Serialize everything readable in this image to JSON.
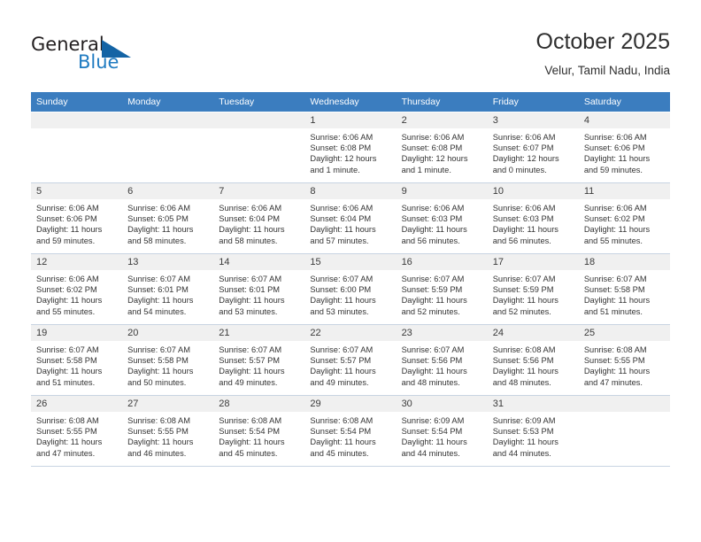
{
  "brand": {
    "name_part1": "General",
    "name_part2": "Blue",
    "triangle_icon": "triangle-logo-icon",
    "accent_color": "#1464a5",
    "blue_text_color": "#1f7bc1"
  },
  "header": {
    "title": "October 2025",
    "location": "Velur, Tamil Nadu, India"
  },
  "colors": {
    "header_row_bg": "#3b7dbf",
    "header_row_text": "#ffffff",
    "daynum_bg": "#f0f0f0",
    "cell_border": "#c8d4e2",
    "body_text": "#333333"
  },
  "weekday_headers": [
    "Sunday",
    "Monday",
    "Tuesday",
    "Wednesday",
    "Thursday",
    "Friday",
    "Saturday"
  ],
  "labels": {
    "sunrise": "Sunrise:",
    "sunset": "Sunset:",
    "daylight": "Daylight:"
  },
  "weeks": [
    [
      {
        "day": "",
        "empty": true
      },
      {
        "day": "",
        "empty": true
      },
      {
        "day": "",
        "empty": true
      },
      {
        "day": "1",
        "sunrise": "Sunrise: 6:06 AM",
        "sunset": "Sunset: 6:08 PM",
        "daylight_line1": "Daylight: 12 hours",
        "daylight_line2": "and 1 minute."
      },
      {
        "day": "2",
        "sunrise": "Sunrise: 6:06 AM",
        "sunset": "Sunset: 6:08 PM",
        "daylight_line1": "Daylight: 12 hours",
        "daylight_line2": "and 1 minute."
      },
      {
        "day": "3",
        "sunrise": "Sunrise: 6:06 AM",
        "sunset": "Sunset: 6:07 PM",
        "daylight_line1": "Daylight: 12 hours",
        "daylight_line2": "and 0 minutes."
      },
      {
        "day": "4",
        "sunrise": "Sunrise: 6:06 AM",
        "sunset": "Sunset: 6:06 PM",
        "daylight_line1": "Daylight: 11 hours",
        "daylight_line2": "and 59 minutes."
      }
    ],
    [
      {
        "day": "5",
        "sunrise": "Sunrise: 6:06 AM",
        "sunset": "Sunset: 6:06 PM",
        "daylight_line1": "Daylight: 11 hours",
        "daylight_line2": "and 59 minutes."
      },
      {
        "day": "6",
        "sunrise": "Sunrise: 6:06 AM",
        "sunset": "Sunset: 6:05 PM",
        "daylight_line1": "Daylight: 11 hours",
        "daylight_line2": "and 58 minutes."
      },
      {
        "day": "7",
        "sunrise": "Sunrise: 6:06 AM",
        "sunset": "Sunset: 6:04 PM",
        "daylight_line1": "Daylight: 11 hours",
        "daylight_line2": "and 58 minutes."
      },
      {
        "day": "8",
        "sunrise": "Sunrise: 6:06 AM",
        "sunset": "Sunset: 6:04 PM",
        "daylight_line1": "Daylight: 11 hours",
        "daylight_line2": "and 57 minutes."
      },
      {
        "day": "9",
        "sunrise": "Sunrise: 6:06 AM",
        "sunset": "Sunset: 6:03 PM",
        "daylight_line1": "Daylight: 11 hours",
        "daylight_line2": "and 56 minutes."
      },
      {
        "day": "10",
        "sunrise": "Sunrise: 6:06 AM",
        "sunset": "Sunset: 6:03 PM",
        "daylight_line1": "Daylight: 11 hours",
        "daylight_line2": "and 56 minutes."
      },
      {
        "day": "11",
        "sunrise": "Sunrise: 6:06 AM",
        "sunset": "Sunset: 6:02 PM",
        "daylight_line1": "Daylight: 11 hours",
        "daylight_line2": "and 55 minutes."
      }
    ],
    [
      {
        "day": "12",
        "sunrise": "Sunrise: 6:06 AM",
        "sunset": "Sunset: 6:02 PM",
        "daylight_line1": "Daylight: 11 hours",
        "daylight_line2": "and 55 minutes."
      },
      {
        "day": "13",
        "sunrise": "Sunrise: 6:07 AM",
        "sunset": "Sunset: 6:01 PM",
        "daylight_line1": "Daylight: 11 hours",
        "daylight_line2": "and 54 minutes."
      },
      {
        "day": "14",
        "sunrise": "Sunrise: 6:07 AM",
        "sunset": "Sunset: 6:01 PM",
        "daylight_line1": "Daylight: 11 hours",
        "daylight_line2": "and 53 minutes."
      },
      {
        "day": "15",
        "sunrise": "Sunrise: 6:07 AM",
        "sunset": "Sunset: 6:00 PM",
        "daylight_line1": "Daylight: 11 hours",
        "daylight_line2": "and 53 minutes."
      },
      {
        "day": "16",
        "sunrise": "Sunrise: 6:07 AM",
        "sunset": "Sunset: 5:59 PM",
        "daylight_line1": "Daylight: 11 hours",
        "daylight_line2": "and 52 minutes."
      },
      {
        "day": "17",
        "sunrise": "Sunrise: 6:07 AM",
        "sunset": "Sunset: 5:59 PM",
        "daylight_line1": "Daylight: 11 hours",
        "daylight_line2": "and 52 minutes."
      },
      {
        "day": "18",
        "sunrise": "Sunrise: 6:07 AM",
        "sunset": "Sunset: 5:58 PM",
        "daylight_line1": "Daylight: 11 hours",
        "daylight_line2": "and 51 minutes."
      }
    ],
    [
      {
        "day": "19",
        "sunrise": "Sunrise: 6:07 AM",
        "sunset": "Sunset: 5:58 PM",
        "daylight_line1": "Daylight: 11 hours",
        "daylight_line2": "and 51 minutes."
      },
      {
        "day": "20",
        "sunrise": "Sunrise: 6:07 AM",
        "sunset": "Sunset: 5:58 PM",
        "daylight_line1": "Daylight: 11 hours",
        "daylight_line2": "and 50 minutes."
      },
      {
        "day": "21",
        "sunrise": "Sunrise: 6:07 AM",
        "sunset": "Sunset: 5:57 PM",
        "daylight_line1": "Daylight: 11 hours",
        "daylight_line2": "and 49 minutes."
      },
      {
        "day": "22",
        "sunrise": "Sunrise: 6:07 AM",
        "sunset": "Sunset: 5:57 PM",
        "daylight_line1": "Daylight: 11 hours",
        "daylight_line2": "and 49 minutes."
      },
      {
        "day": "23",
        "sunrise": "Sunrise: 6:07 AM",
        "sunset": "Sunset: 5:56 PM",
        "daylight_line1": "Daylight: 11 hours",
        "daylight_line2": "and 48 minutes."
      },
      {
        "day": "24",
        "sunrise": "Sunrise: 6:08 AM",
        "sunset": "Sunset: 5:56 PM",
        "daylight_line1": "Daylight: 11 hours",
        "daylight_line2": "and 48 minutes."
      },
      {
        "day": "25",
        "sunrise": "Sunrise: 6:08 AM",
        "sunset": "Sunset: 5:55 PM",
        "daylight_line1": "Daylight: 11 hours",
        "daylight_line2": "and 47 minutes."
      }
    ],
    [
      {
        "day": "26",
        "sunrise": "Sunrise: 6:08 AM",
        "sunset": "Sunset: 5:55 PM",
        "daylight_line1": "Daylight: 11 hours",
        "daylight_line2": "and 47 minutes."
      },
      {
        "day": "27",
        "sunrise": "Sunrise: 6:08 AM",
        "sunset": "Sunset: 5:55 PM",
        "daylight_line1": "Daylight: 11 hours",
        "daylight_line2": "and 46 minutes."
      },
      {
        "day": "28",
        "sunrise": "Sunrise: 6:08 AM",
        "sunset": "Sunset: 5:54 PM",
        "daylight_line1": "Daylight: 11 hours",
        "daylight_line2": "and 45 minutes."
      },
      {
        "day": "29",
        "sunrise": "Sunrise: 6:08 AM",
        "sunset": "Sunset: 5:54 PM",
        "daylight_line1": "Daylight: 11 hours",
        "daylight_line2": "and 45 minutes."
      },
      {
        "day": "30",
        "sunrise": "Sunrise: 6:09 AM",
        "sunset": "Sunset: 5:54 PM",
        "daylight_line1": "Daylight: 11 hours",
        "daylight_line2": "and 44 minutes."
      },
      {
        "day": "31",
        "sunrise": "Sunrise: 6:09 AM",
        "sunset": "Sunset: 5:53 PM",
        "daylight_line1": "Daylight: 11 hours",
        "daylight_line2": "and 44 minutes."
      },
      {
        "day": "",
        "empty": true
      }
    ]
  ]
}
